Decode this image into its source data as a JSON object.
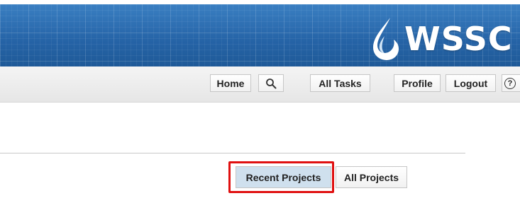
{
  "header": {
    "logo_text": "WSSC",
    "brand_color": "#2b6db0"
  },
  "nav": {
    "home_label": "Home",
    "search_icon": "search-icon",
    "all_tasks_label": "All Tasks",
    "profile_label": "Profile",
    "logout_label": "Logout",
    "help_icon": "help-icon",
    "help_glyph": "?"
  },
  "projects": {
    "tabs": [
      {
        "label": "Recent Projects",
        "selected": true
      },
      {
        "label": "All Projects",
        "selected": false
      }
    ],
    "highlight_color": "#e01010"
  }
}
